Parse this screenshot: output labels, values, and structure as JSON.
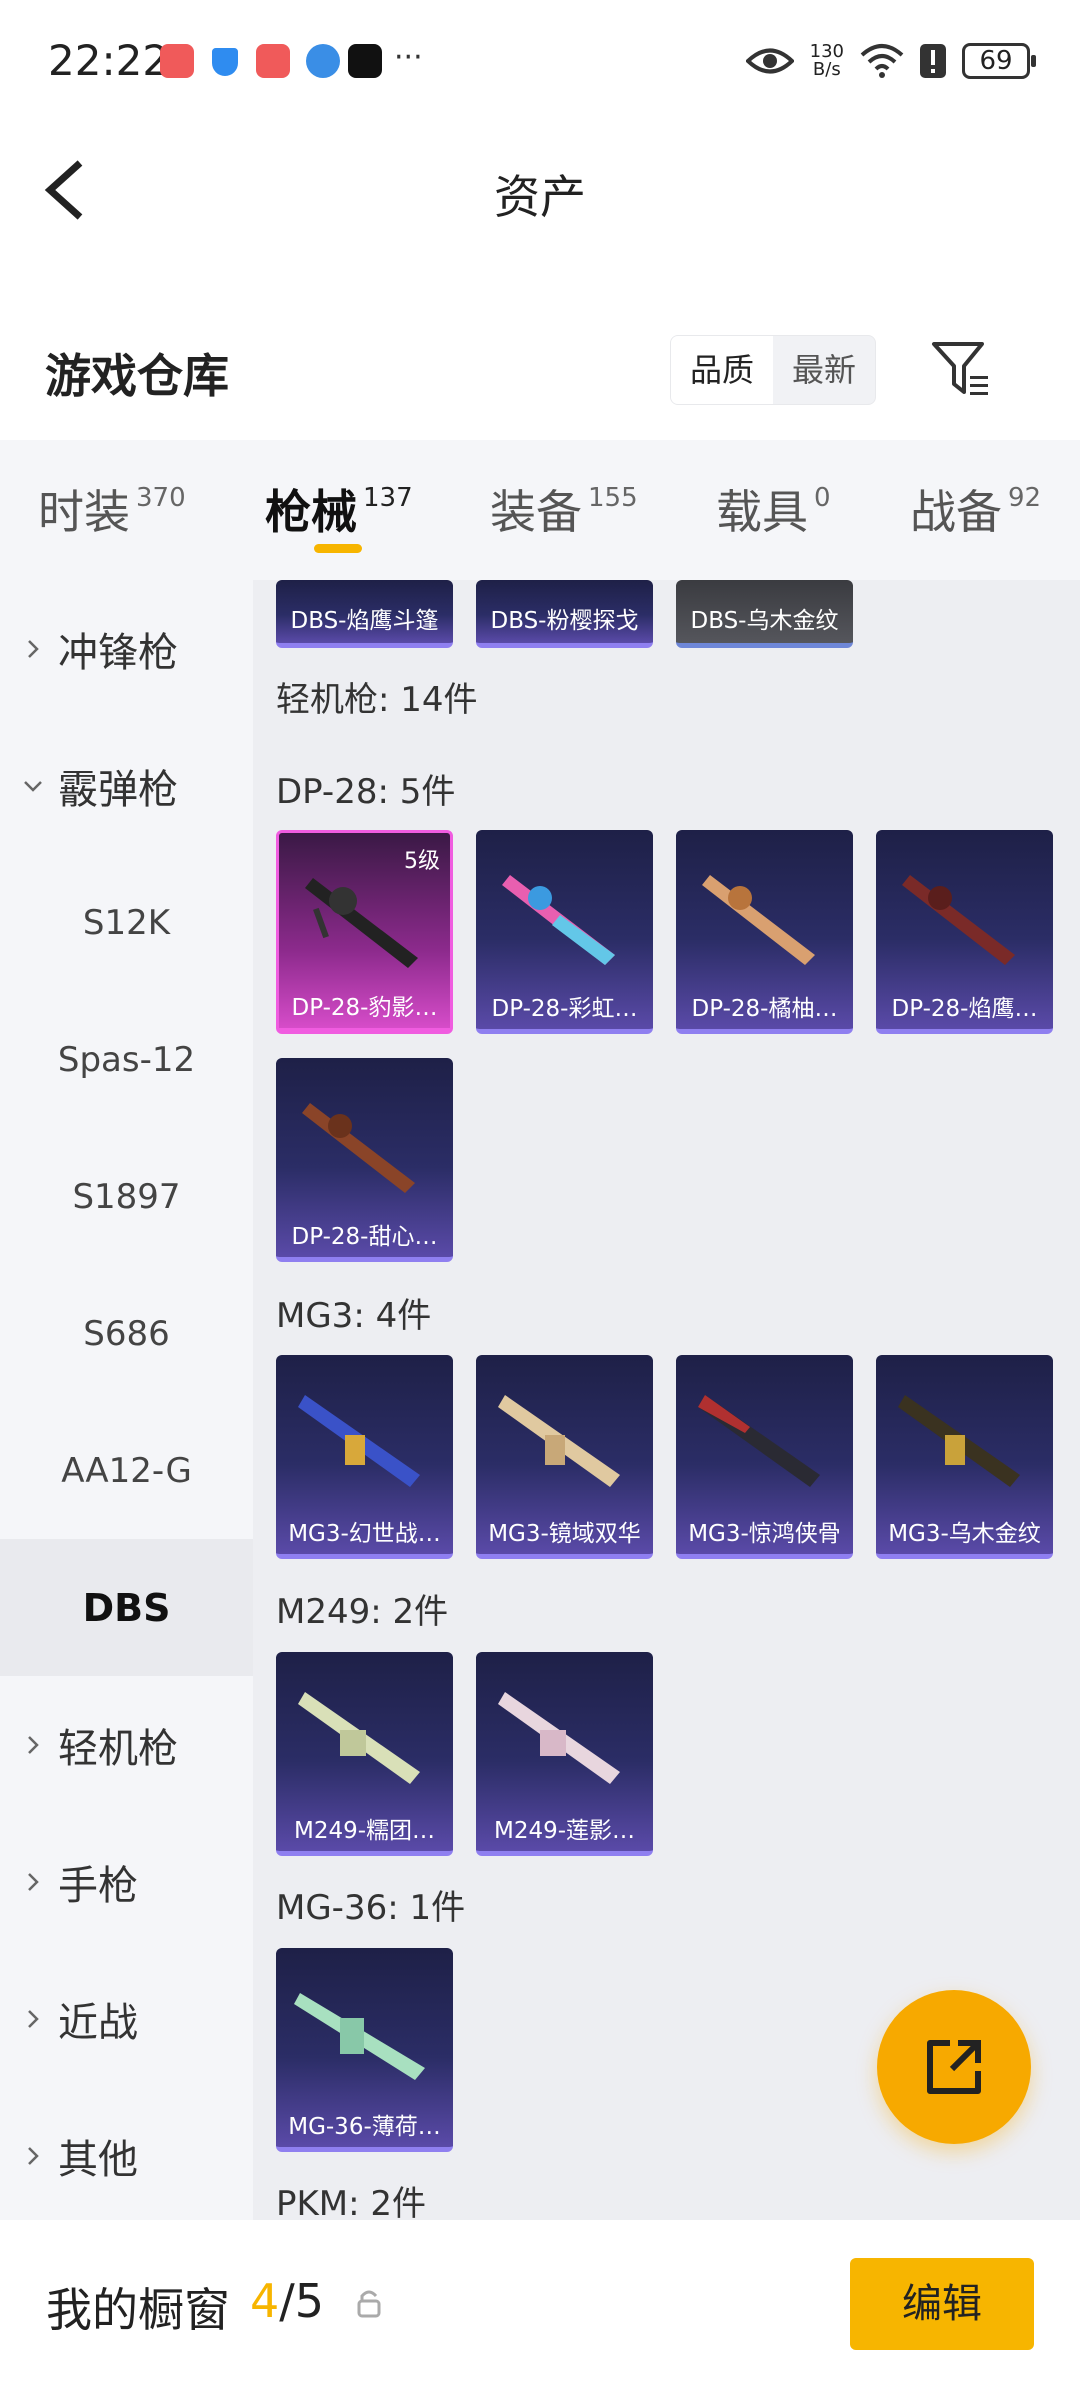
{
  "status_bar": {
    "time": "22:22",
    "net_speed_value": "130",
    "net_speed_unit": "B/s",
    "battery": "69",
    "more": "···"
  },
  "header": {
    "title": "资产"
  },
  "warehouse": {
    "title": "游戏仓库",
    "sort_options": [
      "品质",
      "最新"
    ],
    "sort_selected": "品质"
  },
  "tabs": [
    {
      "label": "时装",
      "count": "370"
    },
    {
      "label": "枪械",
      "count": "137"
    },
    {
      "label": "装备",
      "count": "155"
    },
    {
      "label": "载具",
      "count": "0"
    },
    {
      "label": "战备",
      "count": "92"
    }
  ],
  "sidebar": {
    "items": [
      {
        "label": "冲锋枪"
      },
      {
        "label": "霰弹枪"
      },
      {
        "label": "S12K"
      },
      {
        "label": "Spas-12"
      },
      {
        "label": "S1897"
      },
      {
        "label": "S686"
      },
      {
        "label": "AA12-G"
      },
      {
        "label": "DBS"
      },
      {
        "label": "轻机枪"
      },
      {
        "label": "手枪"
      },
      {
        "label": "近战"
      },
      {
        "label": "其他"
      }
    ]
  },
  "main": {
    "top_cards": [
      "DBS-焰鹰斗篷",
      "DBS-粉樱探戈",
      "DBS-乌木金纹"
    ],
    "category_label": "轻机枪: 14件",
    "groups": [
      {
        "label": "DP-28: 5件",
        "items": [
          "DP-28-豹影…",
          "DP-28-彩虹…",
          "DP-28-橘柚…",
          "DP-28-焰鹰…",
          "DP-28-甜心…"
        ]
      },
      {
        "label": "MG3: 4件",
        "items": [
          "MG3-幻世战…",
          "MG3-镜域双华",
          "MG3-惊鸿侠骨",
          "MG3-乌木金纹"
        ]
      },
      {
        "label": "M249: 2件",
        "items": [
          "M249-糯团…",
          "M249-莲影…"
        ]
      },
      {
        "label": "MG-36: 1件",
        "items": [
          "MG-36-薄荷…"
        ]
      },
      {
        "label": "PKM: 2件",
        "items": []
      }
    ],
    "level_badge": "5级"
  },
  "bottom": {
    "title": "我的橱窗",
    "current": "4",
    "separator_total": "/5",
    "edit_label": "编辑"
  },
  "colors": {
    "accent": "#f7b500",
    "fab": "#f7a900"
  }
}
